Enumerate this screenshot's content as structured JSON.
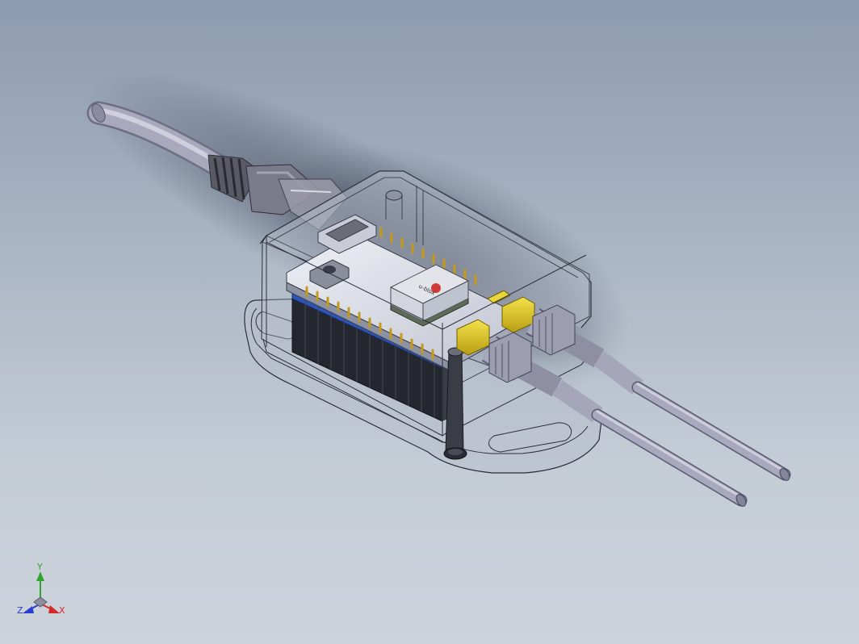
{
  "viewport": {
    "background_top": "#8d9bb0",
    "background_bottom": "#cdd3db"
  },
  "model": {
    "enclosure_color": "#b4bccb",
    "cable_color": "#a3a3b8",
    "pcb_color": "#dcdde6",
    "battery_color": "#2a2c34",
    "battery_stripe_color": "#2d55b8",
    "connector_color": "#e6d23a",
    "module_logo_text": "u-blox"
  },
  "triad": {
    "y_label": "Y",
    "x_label": "X",
    "z_label": "Z",
    "y_color": "#2fa52f",
    "x_color": "#d42a2a",
    "z_color": "#2a3fd4"
  }
}
